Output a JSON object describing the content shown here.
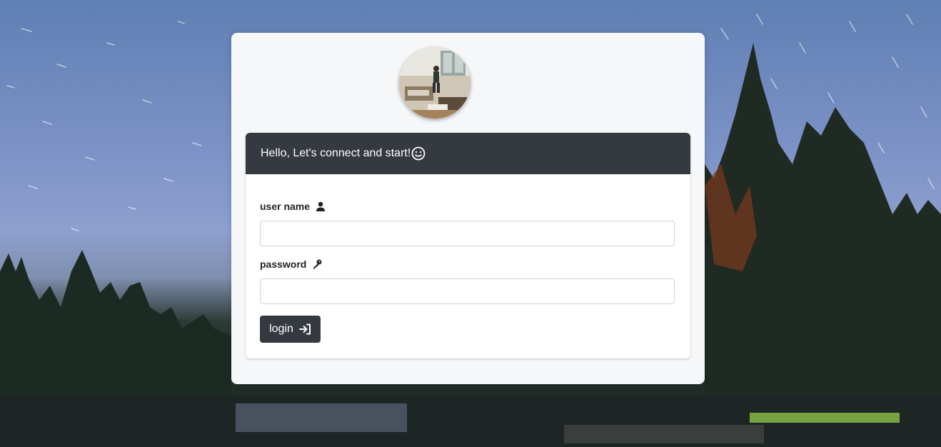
{
  "card": {
    "header_text": "Hello, Let's connect and start!",
    "header_icon": "smile-icon"
  },
  "form": {
    "username_label": "user name",
    "username_icon": "user-icon",
    "username_value": "",
    "password_label": "password",
    "password_icon": "key-icon",
    "password_value": "",
    "login_label": "login",
    "login_icon": "sign-in-icon"
  },
  "colors": {
    "header_bg": "#343a40",
    "button_bg": "#343a40",
    "panel_bg": "#f6f7f9"
  }
}
